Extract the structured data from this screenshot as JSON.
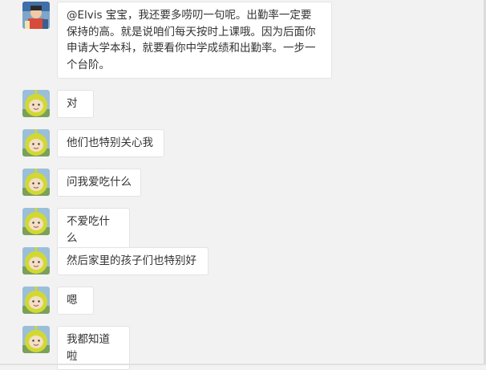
{
  "messages": [
    {
      "avatar": "profile-photo-avatar",
      "text": "@Elvis 宝宝，我还要多唠叨一句呢。出勤率一定要\n保持的高。就是说咱们每天按时上课哦。因为后面你\n申请大学本科，就要看你中学成绩和出勤率。一步一\n个台阶。"
    },
    {
      "avatar": "teletubby-avatar",
      "text": "对"
    },
    {
      "avatar": "teletubby-avatar",
      "text": "他们也特别关心我"
    },
    {
      "avatar": "teletubby-avatar",
      "text": "问我爱吃什么"
    },
    {
      "avatar": "teletubby-avatar",
      "text": "不爱吃什么"
    },
    {
      "avatar": "teletubby-avatar",
      "text": "然后家里的孩子们也特别好"
    },
    {
      "avatar": "teletubby-avatar",
      "text": "嗯"
    },
    {
      "avatar": "teletubby-avatar",
      "text": "我都知道啦"
    }
  ],
  "colors": {
    "background": "#f2f2f2",
    "bubble": "#ffffff",
    "bubble_border": "#e3e3e3",
    "text": "#333333"
  }
}
